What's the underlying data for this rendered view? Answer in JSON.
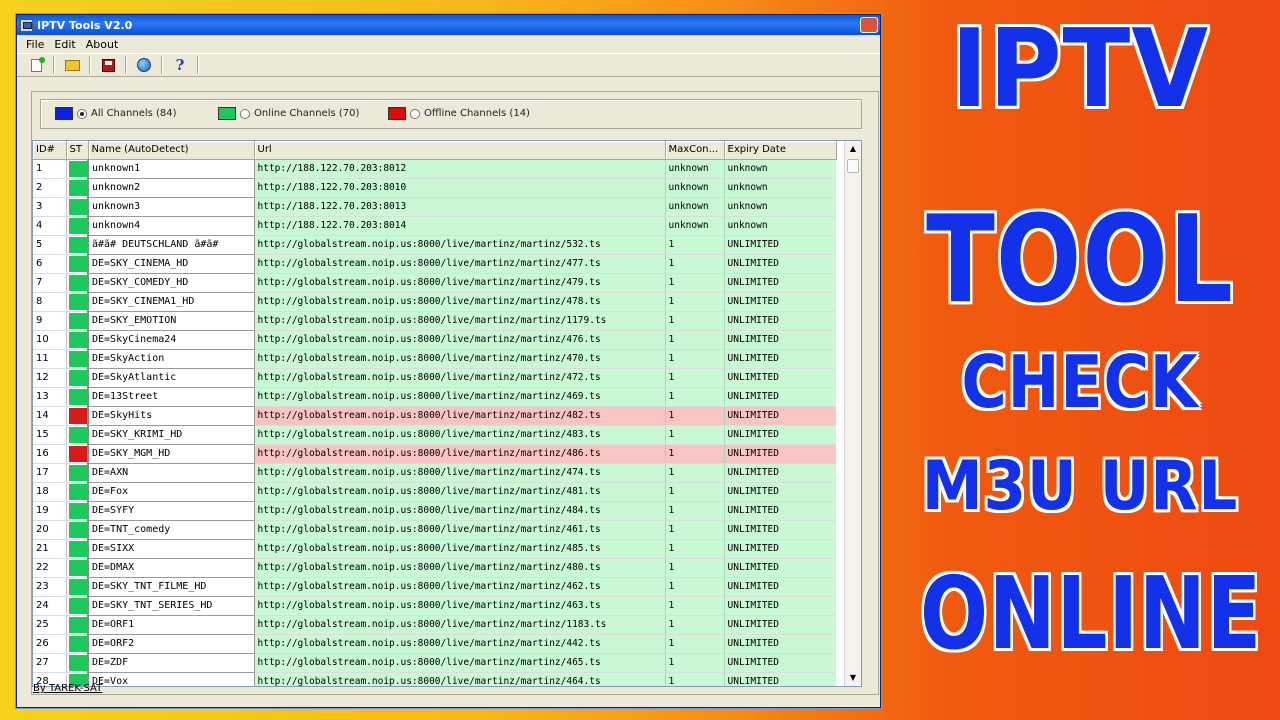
{
  "window": {
    "title": "IPTV Tools V2.0",
    "menu": [
      "File",
      "Edit",
      "About"
    ],
    "toolbar_icons": [
      "new-file-icon",
      "open-folder-icon",
      "save-icon",
      "globe-icon",
      "help-icon"
    ]
  },
  "legend": {
    "all": {
      "label": "All Channels (84)",
      "color": "#0a24e0",
      "selected": true
    },
    "online": {
      "label": "Online Channels (70)",
      "color": "#1ec85a",
      "selected": false
    },
    "offline": {
      "label": "Offline Channels (14)",
      "color": "#e00a0a",
      "selected": false
    }
  },
  "table": {
    "columns": [
      "ID#",
      "ST",
      "Name (AutoDetect)",
      "Url",
      "MaxCon...",
      "Expiry Date"
    ],
    "status_colors": {
      "online": "#1ec85a",
      "offline": "#d81a1a"
    },
    "rows": [
      {
        "id": "1",
        "status": "online",
        "name": "unknown1",
        "url": "http://188.122.70.203:8012",
        "max": "unknown",
        "expiry": "unknown"
      },
      {
        "id": "2",
        "status": "online",
        "name": "unknown2",
        "url": "http://188.122.70.203:8010",
        "max": "unknown",
        "expiry": "unknown"
      },
      {
        "id": "3",
        "status": "online",
        "name": "unknown3",
        "url": "http://188.122.70.203:8013",
        "max": "unknown",
        "expiry": "unknown"
      },
      {
        "id": "4",
        "status": "online",
        "name": "unknown4",
        "url": "http://188.122.70.203:8014",
        "max": "unknown",
        "expiry": "unknown"
      },
      {
        "id": "5",
        "status": "online",
        "name": "ã#ã# DEUTSCHLAND ã#ã#",
        "url": "http://globalstream.noip.us:8000/live/martinz/martinz/532.ts",
        "max": "1",
        "expiry": "UNLIMITED"
      },
      {
        "id": "6",
        "status": "online",
        "name": "DE=SKY_CINEMA_HD",
        "url": "http://globalstream.noip.us:8000/live/martinz/martinz/477.ts",
        "max": "1",
        "expiry": "UNLIMITED"
      },
      {
        "id": "7",
        "status": "online",
        "name": "DE=SKY_COMEDY_HD",
        "url": "http://globalstream.noip.us:8000/live/martinz/martinz/479.ts",
        "max": "1",
        "expiry": "UNLIMITED"
      },
      {
        "id": "8",
        "status": "online",
        "name": "DE=SKY_CINEMA1_HD",
        "url": "http://globalstream.noip.us:8000/live/martinz/martinz/478.ts",
        "max": "1",
        "expiry": "UNLIMITED"
      },
      {
        "id": "9",
        "status": "online",
        "name": "DE=SKY_EMOTION",
        "url": "http://globalstream.noip.us:8000/live/martinz/martinz/1179.ts",
        "max": "1",
        "expiry": "UNLIMITED"
      },
      {
        "id": "10",
        "status": "online",
        "name": "DE=SkyCinema24",
        "url": "http://globalstream.noip.us:8000/live/martinz/martinz/476.ts",
        "max": "1",
        "expiry": "UNLIMITED"
      },
      {
        "id": "11",
        "status": "online",
        "name": "DE=SkyAction",
        "url": "http://globalstream.noip.us:8000/live/martinz/martinz/470.ts",
        "max": "1",
        "expiry": "UNLIMITED"
      },
      {
        "id": "12",
        "status": "online",
        "name": "DE=SkyAtlantic",
        "url": "http://globalstream.noip.us:8000/live/martinz/martinz/472.ts",
        "max": "1",
        "expiry": "UNLIMITED"
      },
      {
        "id": "13",
        "status": "online",
        "name": "DE=13Street",
        "url": "http://globalstream.noip.us:8000/live/martinz/martinz/469.ts",
        "max": "1",
        "expiry": "UNLIMITED"
      },
      {
        "id": "14",
        "status": "offline",
        "name": "DE=SkyHits",
        "url": "http://globalstream.noip.us:8000/live/martinz/martinz/482.ts",
        "max": "1",
        "expiry": "UNLIMITED"
      },
      {
        "id": "15",
        "status": "online",
        "name": "DE=SKY_KRIMI_HD",
        "url": "http://globalstream.noip.us:8000/live/martinz/martinz/483.ts",
        "max": "1",
        "expiry": "UNLIMITED"
      },
      {
        "id": "16",
        "status": "offline",
        "name": "DE=SKY_MGM_HD",
        "url": "http://globalstream.noip.us:8000/live/martinz/martinz/486.ts",
        "max": "1",
        "expiry": "UNLIMITED"
      },
      {
        "id": "17",
        "status": "online",
        "name": "DE=AXN",
        "url": "http://globalstream.noip.us:8000/live/martinz/martinz/474.ts",
        "max": "1",
        "expiry": "UNLIMITED"
      },
      {
        "id": "18",
        "status": "online",
        "name": "DE=Fox",
        "url": "http://globalstream.noip.us:8000/live/martinz/martinz/481.ts",
        "max": "1",
        "expiry": "UNLIMITED"
      },
      {
        "id": "19",
        "status": "online",
        "name": "DE=SYFY",
        "url": "http://globalstream.noip.us:8000/live/martinz/martinz/484.ts",
        "max": "1",
        "expiry": "UNLIMITED"
      },
      {
        "id": "20",
        "status": "online",
        "name": "DE=TNT_comedy",
        "url": "http://globalstream.noip.us:8000/live/martinz/martinz/461.ts",
        "max": "1",
        "expiry": "UNLIMITED"
      },
      {
        "id": "21",
        "status": "online",
        "name": "DE=SIXX",
        "url": "http://globalstream.noip.us:8000/live/martinz/martinz/485.ts",
        "max": "1",
        "expiry": "UNLIMITED"
      },
      {
        "id": "22",
        "status": "online",
        "name": "DE=DMAX",
        "url": "http://globalstream.noip.us:8000/live/martinz/martinz/480.ts",
        "max": "1",
        "expiry": "UNLIMITED"
      },
      {
        "id": "23",
        "status": "online",
        "name": "DE=SKY_TNT_FILME_HD",
        "url": "http://globalstream.noip.us:8000/live/martinz/martinz/462.ts",
        "max": "1",
        "expiry": "UNLIMITED"
      },
      {
        "id": "24",
        "status": "online",
        "name": "DE=SKY_TNT_SERIES_HD",
        "url": "http://globalstream.noip.us:8000/live/martinz/martinz/463.ts",
        "max": "1",
        "expiry": "UNLIMITED"
      },
      {
        "id": "25",
        "status": "online",
        "name": "DE=ORF1",
        "url": "http://globalstream.noip.us:8000/live/martinz/martinz/1183.ts",
        "max": "1",
        "expiry": "UNLIMITED"
      },
      {
        "id": "26",
        "status": "online",
        "name": "DE=ORF2",
        "url": "http://globalstream.noip.us:8000/live/martinz/martinz/442.ts",
        "max": "1",
        "expiry": "UNLIMITED"
      },
      {
        "id": "27",
        "status": "online",
        "name": "DE=ZDF",
        "url": "http://globalstream.noip.us:8000/live/martinz/martinz/465.ts",
        "max": "1",
        "expiry": "UNLIMITED"
      },
      {
        "id": "28",
        "status": "online",
        "name": "DE=Vox",
        "url": "http://globalstream.noip.us:8000/live/martinz/martinz/464.ts",
        "max": "1",
        "expiry": "UNLIMITED"
      }
    ]
  },
  "footer": "By TAREK-SAT",
  "headline": {
    "line1": "IPTV",
    "line2": "TOOL",
    "line3": "CHECK",
    "line4": "M3U URL",
    "line5": "ONLINE",
    "color": "#1231e8"
  }
}
